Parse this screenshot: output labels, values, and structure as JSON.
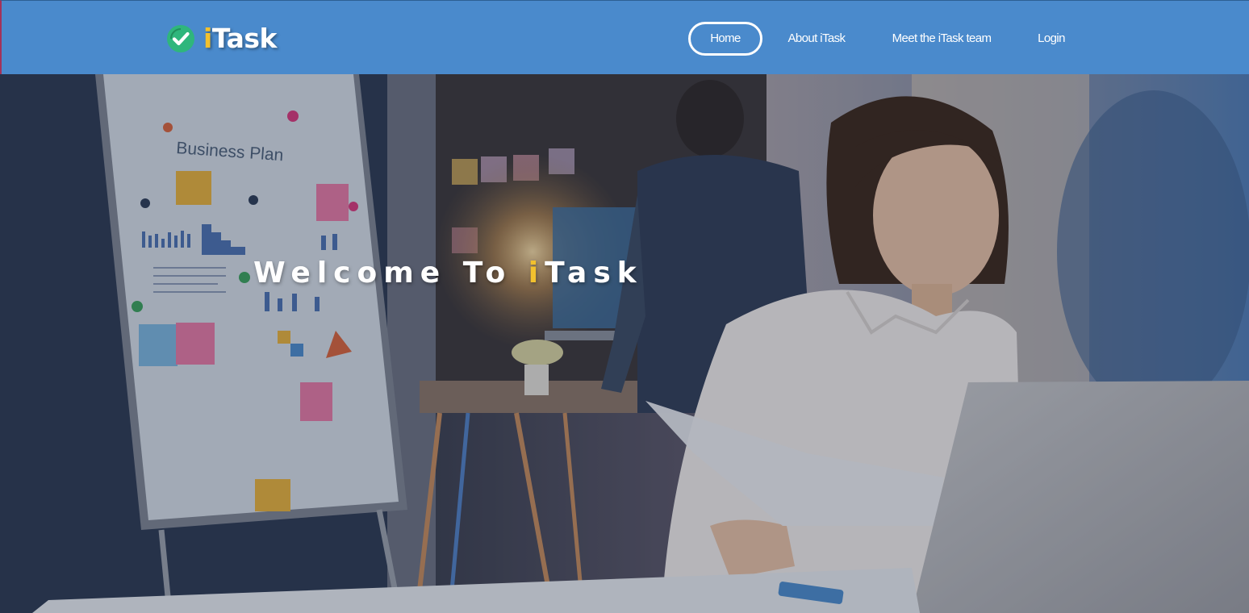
{
  "brand": {
    "prefix": "i",
    "name": "Task",
    "icon": "check-circle-icon",
    "accent_color": "#f2c12e",
    "check_color": "#2fb67c"
  },
  "nav": {
    "home": "Home",
    "about": "About iTask",
    "team": "Meet the iTask team",
    "login": "Login",
    "active": "Home"
  },
  "hero": {
    "title_before": "Welcome To ",
    "title_accent": "i",
    "title_after": "Task",
    "whiteboard_label": "Business Plan"
  },
  "colors": {
    "navbar": "#4a8acc",
    "accent": "#f2c12e",
    "text": "#ffffff"
  }
}
